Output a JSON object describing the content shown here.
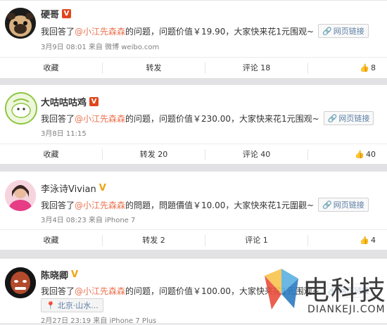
{
  "posts": [
    {
      "user": "硬哥",
      "badge": "V",
      "text_prefix": "我回答了",
      "mention": "@小江先森森",
      "text_suffix": " 的问题，问题价值￥19.90，大家快来花1元围观~",
      "link_label": "网页链接",
      "meta": "3月9日 08:01 来自 微博 weibo.com",
      "actions": [
        "收藏",
        "转发",
        "评论 18",
        "8"
      ]
    },
    {
      "user": "大咕咕咕鸡",
      "badge": "V",
      "text_prefix": "我回答了",
      "mention": "@小江先森森",
      "text_suffix": " 的问题，问题价值￥230.00，大家快来花1元围观~",
      "link_label": "网页链接",
      "meta": "3月8日 11:15",
      "actions": [
        "收藏",
        "转发 20",
        "评论 40",
        "40"
      ]
    },
    {
      "user": "李泳诗Vivian",
      "badge": "V",
      "text_prefix": "我回答了",
      "mention": "@小江先森森",
      "text_suffix": " 的問題，問題價值￥10.00，大家快來花1元圍觀~",
      "link_label": "网页链接",
      "meta": "3月4日 08:23 来自 iPhone 7",
      "actions": [
        "收藏",
        "转发 2",
        "评论 1",
        "4"
      ]
    },
    {
      "user": "陈晓卿",
      "badge": "V",
      "text_prefix": "我回答了",
      "mention": "@小江先森森",
      "text_suffix": " 的问题，问题价值￥100.00，大家快来花1元围观~",
      "link_label": "网页链接",
      "location": "北京·山水...",
      "meta": "2月27日 23:19 来自 iPhone 7 Plus"
    }
  ],
  "watermark": {
    "brand": "电科技",
    "url": "DIANKEJI.COM"
  },
  "colors": {
    "accent": "#eb7350",
    "link": "#5d7fa6",
    "verified_red": "#e0461d",
    "verified_gold": "#f2a20c"
  }
}
